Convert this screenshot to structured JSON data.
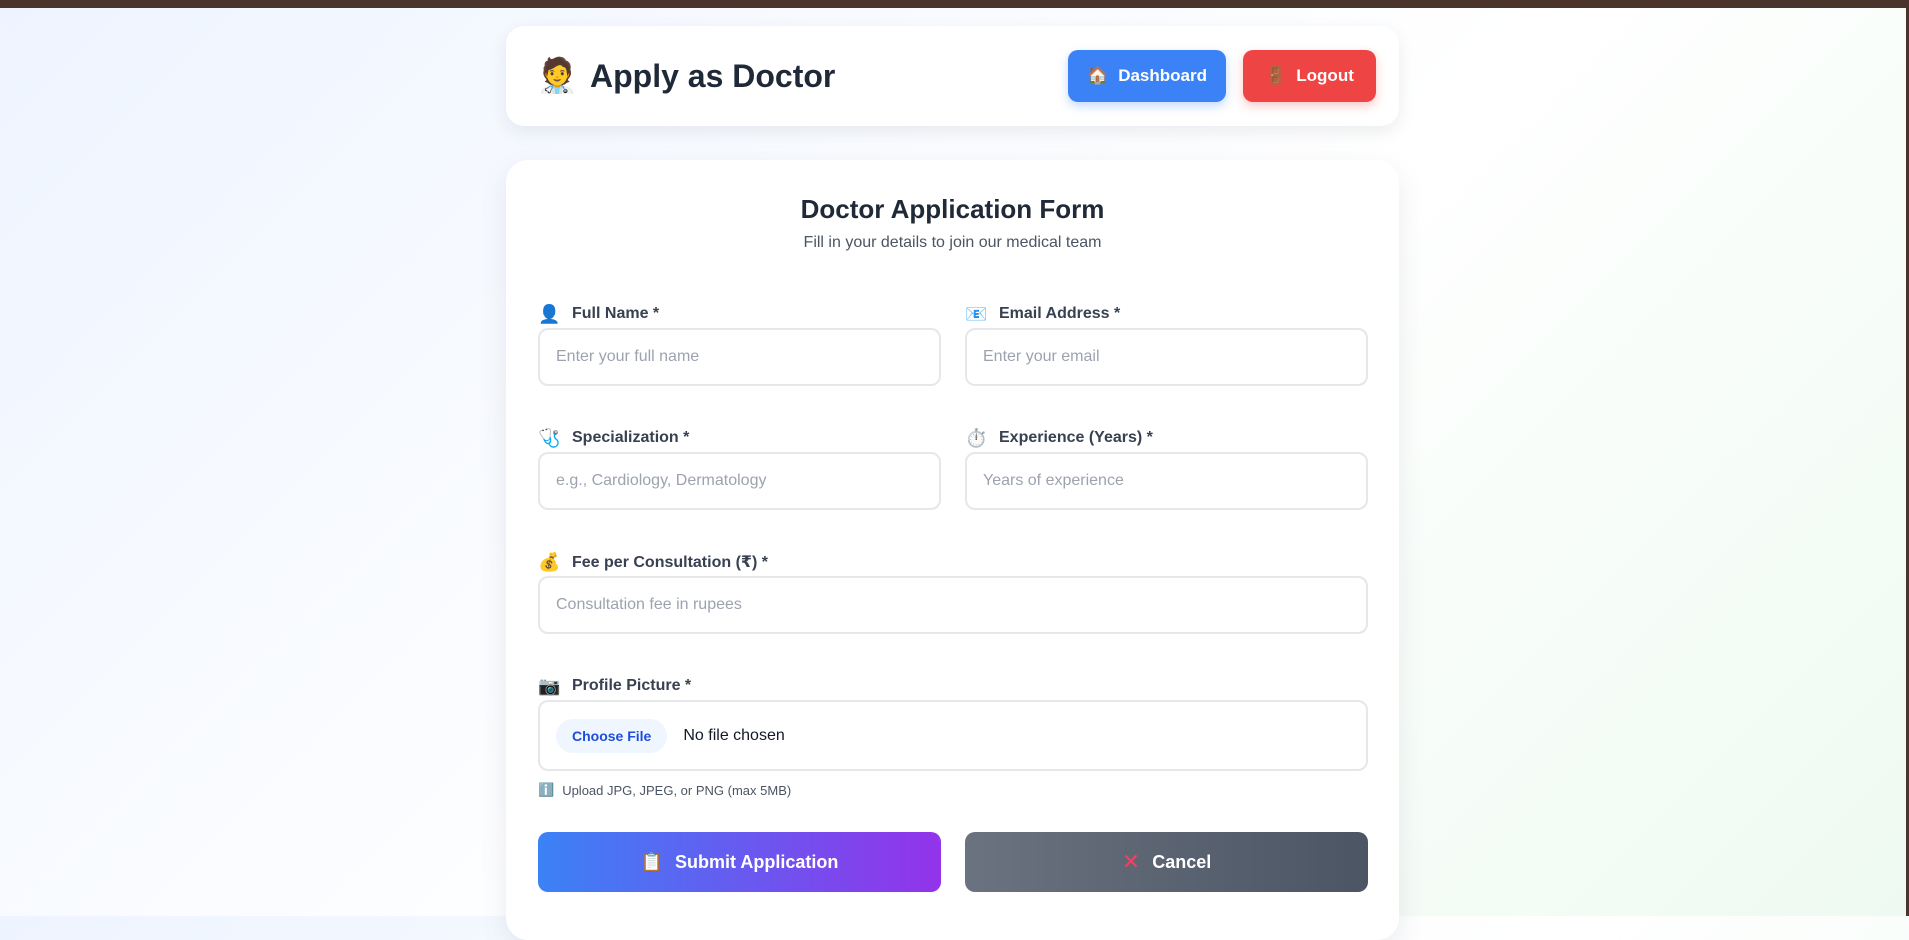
{
  "header": {
    "icon": "doctor-emoji",
    "title": "Apply as Doctor",
    "dashboard_label": "Dashboard",
    "dashboard_icon": "house-icon",
    "logout_label": "Logout",
    "logout_icon": "door-icon"
  },
  "form": {
    "title": "Doctor Application Form",
    "subtitle": "Fill in your details to join our medical team",
    "full_name": {
      "label": "Full Name *",
      "placeholder": "Enter your full name",
      "value": ""
    },
    "email": {
      "label": "Email Address *",
      "placeholder": "Enter your email",
      "value": ""
    },
    "specialization": {
      "label": "Specialization *",
      "placeholder": "e.g., Cardiology, Dermatology",
      "value": ""
    },
    "experience": {
      "label": "Experience (Years) *",
      "placeholder": "Years of experience",
      "value": ""
    },
    "fee": {
      "label": "Fee per Consultation (₹) *",
      "placeholder": "Consultation fee in rupees",
      "value": ""
    },
    "profile_picture": {
      "label": "Profile Picture *",
      "choose_label": "Choose File",
      "file_status": "No file chosen",
      "hint": "Upload JPG, JPEG, or PNG (max 5MB)"
    },
    "submit_label": "Submit Application",
    "cancel_label": "Cancel"
  },
  "colors": {
    "primary": "#3b82f6",
    "danger": "#ef4444",
    "gradient_end": "#9333ea",
    "cancel_gray": "#6b7280",
    "topbar": "#4a342b"
  }
}
